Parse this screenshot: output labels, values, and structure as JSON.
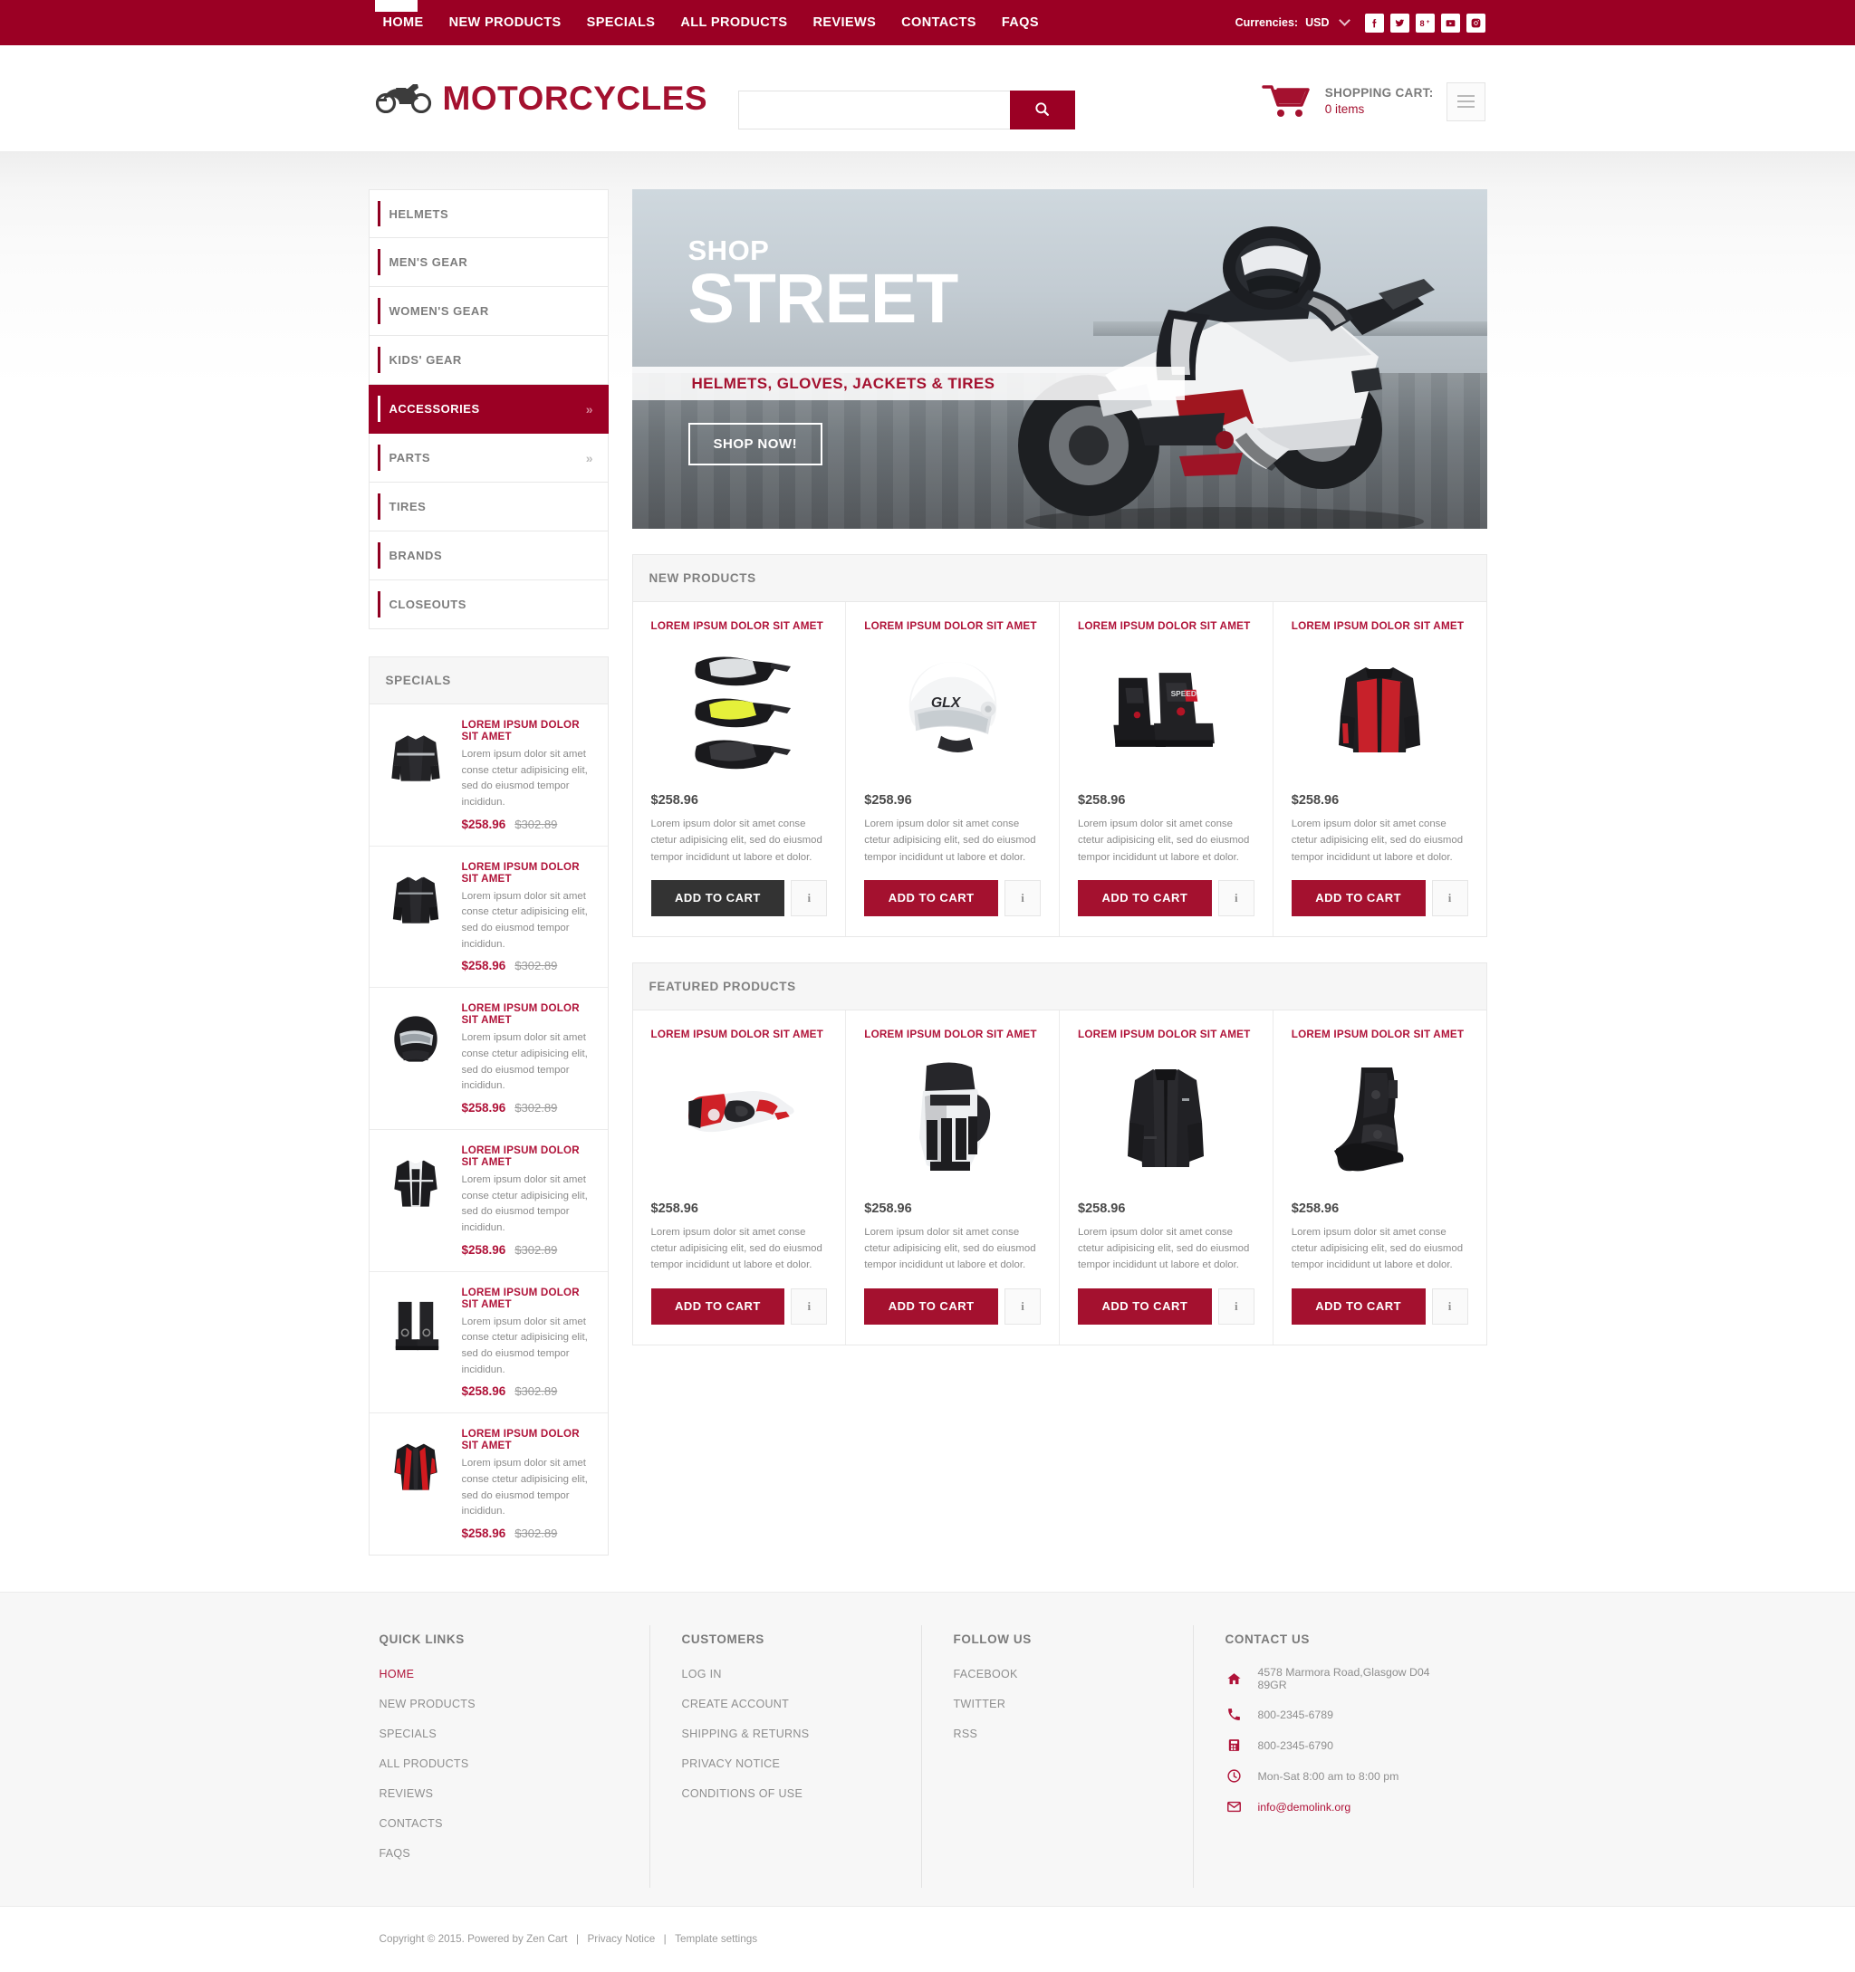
{
  "topbar": {
    "nav": [
      {
        "label": "HOME"
      },
      {
        "label": "NEW PRODUCTS"
      },
      {
        "label": "SPECIALS"
      },
      {
        "label": "ALL PRODUCTS"
      },
      {
        "label": "REVIEWS"
      },
      {
        "label": "CONTACTS"
      },
      {
        "label": "FAQS"
      }
    ],
    "currency_label": "Currencies:",
    "currency_value": "USD",
    "socials": [
      {
        "name": "facebook-icon"
      },
      {
        "name": "twitter-icon"
      },
      {
        "name": "google-plus-icon"
      },
      {
        "name": "youtube-icon"
      },
      {
        "name": "instagram-icon"
      }
    ]
  },
  "header": {
    "logo_text": "MOTORCYCLES",
    "search_value": "",
    "search_placeholder": "",
    "cart_title": "SHOPPING CART:",
    "cart_items": "0 items"
  },
  "categories": [
    {
      "label": "HELMETS",
      "active": false,
      "arrow": ""
    },
    {
      "label": "MEN'S GEAR",
      "active": false,
      "arrow": ""
    },
    {
      "label": "WOMEN'S GEAR",
      "active": false,
      "arrow": ""
    },
    {
      "label": "KIDS' GEAR",
      "active": false,
      "arrow": ""
    },
    {
      "label": "ACCESSORIES",
      "active": true,
      "arrow": "»"
    },
    {
      "label": "PARTS",
      "active": false,
      "arrow": "»"
    },
    {
      "label": "TIRES",
      "active": false,
      "arrow": ""
    },
    {
      "label": "BRANDS",
      "active": false,
      "arrow": ""
    },
    {
      "label": "CLOSEOUTS",
      "active": false,
      "arrow": ""
    }
  ],
  "hero": {
    "line1": "SHOP",
    "line2": "STREET",
    "band": "HELMETS,  GLOVES,  JACKETS & TIRES",
    "button": "SHOP NOW!"
  },
  "specials": {
    "heading": "SPECIALS",
    "items": [
      {
        "title": "LOREM IPSUM DOLOR SIT AMET",
        "desc": "Lorem ipsum dolor sit amet conse ctetur adipisicing elit, sed do eiusmod tempor incididun.",
        "price": "$258.96",
        "old_price": "$302.89",
        "thumb": "jacket-black"
      },
      {
        "title": "LOREM IPSUM DOLOR SIT AMET",
        "desc": "Lorem ipsum dolor sit amet conse ctetur adipisicing elit, sed do eiusmod tempor incididun.",
        "price": "$258.96",
        "old_price": "$302.89",
        "thumb": "jacket-black2"
      },
      {
        "title": "LOREM IPSUM DOLOR SIT AMET",
        "desc": "Lorem ipsum dolor sit amet conse ctetur adipisicing elit, sed do eiusmod tempor incididun.",
        "price": "$258.96",
        "old_price": "$302.89",
        "thumb": "helmet-full"
      },
      {
        "title": "LOREM IPSUM DOLOR SIT AMET",
        "desc": "Lorem ipsum dolor sit amet conse ctetur adipisicing elit, sed do eiusmod tempor incididun.",
        "price": "$258.96",
        "old_price": "$302.89",
        "thumb": "jacket-white-stripe"
      },
      {
        "title": "LOREM IPSUM DOLOR SIT AMET",
        "desc": "Lorem ipsum dolor sit amet conse ctetur adipisicing elit, sed do eiusmod tempor incididun.",
        "price": "$258.96",
        "old_price": "$302.89",
        "thumb": "boots-tall"
      },
      {
        "title": "LOREM IPSUM DOLOR SIT AMET",
        "desc": "Lorem ipsum dolor sit amet conse ctetur adipisicing elit, sed do eiusmod tempor incididun.",
        "price": "$258.96",
        "old_price": "$302.89",
        "thumb": "jacket-red"
      }
    ]
  },
  "new_products": {
    "heading": "NEW PRODUCTS",
    "items": [
      {
        "title": "LOREM IPSUM DOLOR SIT AMET",
        "price": "$258.96",
        "desc": "Lorem ipsum dolor sit amet conse ctetur adipisicing elit, sed do eiusmod tempor incididunt ut labore et dolor.",
        "cart_label": "ADD TO CART",
        "info_label": "i",
        "image": "goggles-trio",
        "hover": true
      },
      {
        "title": "LOREM IPSUM DOLOR SIT AMET",
        "price": "$258.96",
        "desc": "Lorem ipsum dolor sit amet conse ctetur adipisicing elit, sed do eiusmod tempor incididunt ut labore et dolor.",
        "cart_label": "ADD TO CART",
        "info_label": "i",
        "image": "helmet-white-glx",
        "hover": false
      },
      {
        "title": "LOREM IPSUM DOLOR SIT AMET",
        "price": "$258.96",
        "desc": "Lorem ipsum dolor sit amet conse ctetur adipisicing elit, sed do eiusmod tempor incididunt ut labore et dolor.",
        "cart_label": "ADD TO CART",
        "info_label": "i",
        "image": "boots-racing",
        "hover": false
      },
      {
        "title": "LOREM IPSUM DOLOR SIT AMET",
        "price": "$258.96",
        "desc": "Lorem ipsum dolor sit amet conse ctetur adipisicing elit, sed do eiusmod tempor incididunt ut labore et dolor.",
        "cart_label": "ADD TO CART",
        "info_label": "i",
        "image": "jacket-red-black",
        "hover": false
      }
    ]
  },
  "featured_products": {
    "heading": "FEATURED PRODUCTS",
    "items": [
      {
        "title": "LOREM IPSUM DOLOR SIT AMET",
        "price": "$258.96",
        "desc": "Lorem ipsum dolor sit amet conse ctetur adipisicing elit, sed do eiusmod tempor incididunt ut labore et dolor.",
        "cart_label": "ADD TO CART",
        "info_label": "i",
        "image": "glove-red-white",
        "hover": false
      },
      {
        "title": "LOREM IPSUM DOLOR SIT AMET",
        "price": "$258.96",
        "desc": "Lorem ipsum dolor sit amet conse ctetur adipisicing elit, sed do eiusmod tempor incididunt ut labore et dolor.",
        "cart_label": "ADD TO CART",
        "info_label": "i",
        "image": "glove-black-white",
        "hover": false
      },
      {
        "title": "LOREM IPSUM DOLOR SIT AMET",
        "price": "$258.96",
        "desc": "Lorem ipsum dolor sit amet conse ctetur adipisicing elit, sed do eiusmod tempor incididunt ut labore et dolor.",
        "cart_label": "ADD TO CART",
        "info_label": "i",
        "image": "jacket-black-textile",
        "hover": false
      },
      {
        "title": "LOREM IPSUM DOLOR SIT AMET",
        "price": "$258.96",
        "desc": "Lorem ipsum dolor sit amet conse ctetur adipisicing elit, sed do eiusmod tempor incididunt ut labore et dolor.",
        "cart_label": "ADD TO CART",
        "info_label": "i",
        "image": "boot-short-black",
        "hover": false
      }
    ]
  },
  "footer": {
    "quick_links": {
      "heading": "QUICK LINKS",
      "items": [
        {
          "label": "HOME",
          "highlight": true
        },
        {
          "label": "NEW PRODUCTS",
          "highlight": false
        },
        {
          "label": "SPECIALS",
          "highlight": false
        },
        {
          "label": "ALL PRODUCTS",
          "highlight": false
        },
        {
          "label": "REVIEWS",
          "highlight": false
        },
        {
          "label": "CONTACTS",
          "highlight": false
        },
        {
          "label": "FAQS",
          "highlight": false
        }
      ]
    },
    "customers": {
      "heading": "CUSTOMERS",
      "items": [
        {
          "label": "LOG IN"
        },
        {
          "label": "CREATE ACCOUNT"
        },
        {
          "label": "SHIPPING & RETURNS"
        },
        {
          "label": "PRIVACY NOTICE"
        },
        {
          "label": "CONDITIONS OF USE"
        }
      ]
    },
    "follow": {
      "heading": "FOLLOW US",
      "items": [
        {
          "label": "FACEBOOK"
        },
        {
          "label": "TWITTER"
        },
        {
          "label": "RSS"
        }
      ]
    },
    "contact": {
      "heading": "CONTACT US",
      "rows": [
        {
          "icon": "home-icon",
          "text": "4578 Marmora Road,Glasgow D04 89GR",
          "is_mail": false
        },
        {
          "icon": "phone-icon",
          "text": "800-2345-6789",
          "is_mail": false
        },
        {
          "icon": "fax-icon",
          "text": "800-2345-6790",
          "is_mail": false
        },
        {
          "icon": "clock-icon",
          "text": "Mon-Sat 8:00 am to 8:00 pm",
          "is_mail": false
        },
        {
          "icon": "envelope-icon",
          "text": "info@demolink.org",
          "is_mail": true
        }
      ]
    }
  },
  "copyright": {
    "text": "Copyright © 2015. Powered by Zen Cart",
    "link1": "Privacy Notice",
    "link2": "Template settings"
  },
  "colors": {
    "brand": "#9b0024",
    "brand_link": "#b01339",
    "logo": "#a4112f",
    "dark_button": "#333333"
  }
}
